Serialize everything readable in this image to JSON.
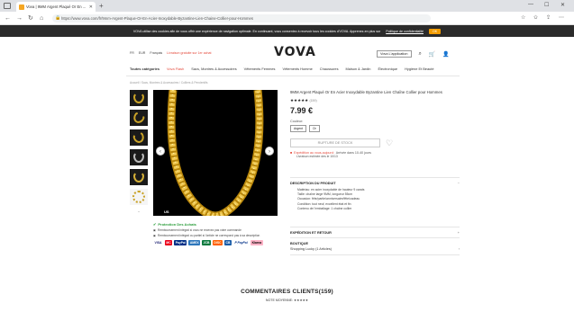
{
  "browser": {
    "tab_title": "Vova | 9MM Argent Plaqué Or En ...",
    "url": "https://www.vova.com/fr/9mm-Argent-Plaque-Or-En-Acier-Inoxydable-Byzantine-Lien-Chaine-Collier-pour-Hommes"
  },
  "cookie_banner": {
    "text": "VOVA utilise des cookies afin de vous offrir une expérience de navigation optimale. En continuant, vous consentez à recevoir tous les cookies d'VOVA. Apprenez-en plus sur",
    "link": "Politique de confidentialité",
    "accept": "OK"
  },
  "header": {
    "country": "FR",
    "currency": "EUR",
    "language": "Français",
    "promo": "Livraison gratuite sur 1er achat",
    "logo": "VOVA",
    "app": "Vova L'application"
  },
  "nav": {
    "items": [
      "Toutes catégories",
      "Vova Flash",
      "Sacs, Montres & Accessoires",
      "Vêtements Femmes",
      "Vêtements Homme",
      "Chaussures",
      "Maison & Jardin",
      "Électronique",
      "Hygiène Et Beauté"
    ]
  },
  "breadcrumb": "Accueil / Sacs, Montres & Accessoires / Colliers & Pendentifs",
  "gallery": {
    "badge": "US"
  },
  "protection": {
    "title": "Protection Des Achats",
    "rows": [
      "Remboursement intégral si vous ne recevez pas votre commande",
      "Remboursement intégral ou partiel si l'article ne correspond pas à sa description"
    ],
    "payments": [
      "VISA",
      "MC",
      "PayPal",
      "AMEX",
      "JCB",
      "DISC",
      "CB",
      "P PayPal",
      "Klarna"
    ]
  },
  "product": {
    "title": "9MM Argent Plaqué Or En Acier Inoxydable Byzantine Lien Chaîne Collier pour Hommes",
    "stars": "★★★★★",
    "rating_count": "(159)",
    "price": "7.99 €",
    "option_label": "Couleur:",
    "options": [
      "Argent",
      "Or"
    ],
    "out_of_stock": "RUPTURE DE STOCK",
    "shipping": "Expédition au vous-aujourd:",
    "shipping_detail": "Arrivée dans 10-40 jours",
    "shipping_eta": "Livraison estimée des le 10/13"
  },
  "description": {
    "heading": "DESCRIPTION DU PRODUIT",
    "lines": [
      "Matériau: en acier inoxydable de hauteur 9 carats",
      "Taille: chaîne large 9MM, longueur 55cm",
      "Occasion: fête/partie/anniversaire/fête/cadeau",
      "Condition: tout neuf, excellent état et fin",
      "Contenu de l'emballage: 1 chaîne collier"
    ]
  },
  "expedition": {
    "heading": "EXPÉDITION ET RETOUR"
  },
  "shop": {
    "heading": "BOUTIQUE",
    "name": "Shopping Lucky (1 Articles)"
  },
  "reviews": {
    "title": "COMMENTAIRES CLIENTS(159)",
    "rating_label": "NOTE MOYENNE:",
    "rating_stars": "★★★★★"
  }
}
